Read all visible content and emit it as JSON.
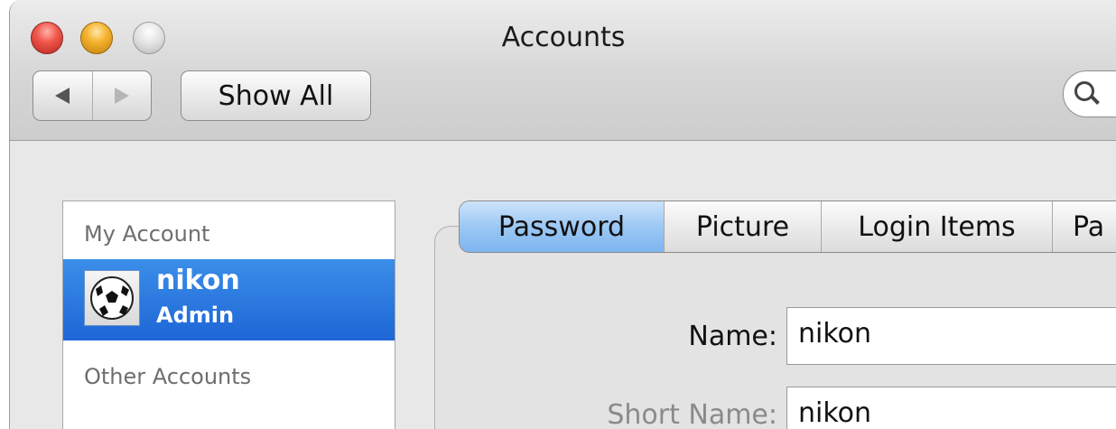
{
  "window": {
    "title": "Accounts",
    "colors": {
      "selection": "#1d66d6",
      "close": "#f0574d",
      "minimize": "#f5b32f"
    }
  },
  "toolbar": {
    "back_icon": "back-arrow-icon",
    "forward_icon": "forward-arrow-icon",
    "show_all_label": "Show All",
    "search_icon": "magnifier-icon"
  },
  "sidebar": {
    "my_account_header": "My Account",
    "selected_user": {
      "name": "nikon",
      "role": "Admin",
      "avatar_icon": "soccer-ball-icon"
    },
    "other_accounts_header": "Other Accounts"
  },
  "tabs": [
    {
      "label": "Password",
      "active": true
    },
    {
      "label": "Picture",
      "active": false
    },
    {
      "label": "Login Items",
      "active": false
    },
    {
      "label": "Pa",
      "active": false
    }
  ],
  "form": {
    "name_label": "Name:",
    "name_value": "nikon",
    "short_name_label": "Short Name:",
    "short_name_value": "nikon"
  }
}
